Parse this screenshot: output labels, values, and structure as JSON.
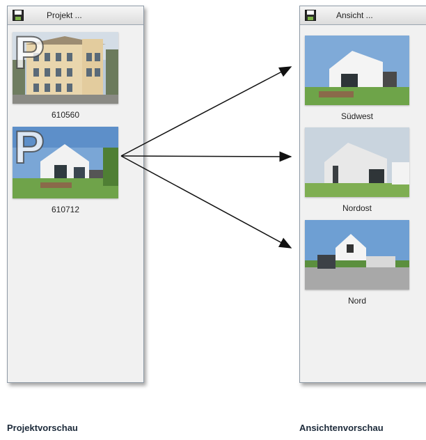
{
  "left_panel": {
    "title": "Projekt ...",
    "items": [
      {
        "caption": "610560",
        "badge": "P"
      },
      {
        "caption": "610712",
        "badge": "P"
      }
    ]
  },
  "right_panel": {
    "title": "Ansicht ...",
    "items": [
      {
        "caption": "Südwest"
      },
      {
        "caption": "Nordost"
      },
      {
        "caption": "Nord"
      }
    ]
  },
  "labels": {
    "left": "Projektvorschau",
    "right": "Ansichtenvorschau"
  },
  "icons": {
    "save": "floppy-disk-icon"
  }
}
